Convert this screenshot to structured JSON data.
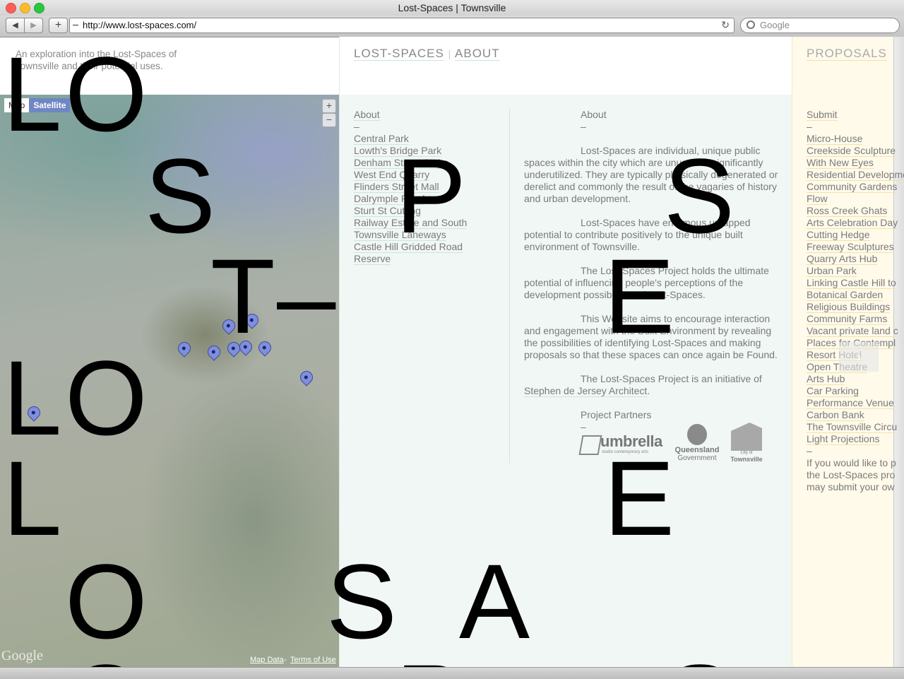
{
  "browser": {
    "window_title": "Lost-Spaces | Townsville",
    "url": "http://www.lost-spaces.com/",
    "search_placeholder": "Google",
    "back_glyph": "◀",
    "forward_glyph": "▶",
    "add_glyph": "+",
    "reload_glyph": "↻"
  },
  "site": {
    "tagline": "An exploration into the Lost-Spaces of Townsville and their potential uses.",
    "nav": {
      "brand": "LOST-SPACES",
      "separator": "|",
      "about": "ABOUT",
      "proposals": "PROPOSALS"
    }
  },
  "map": {
    "type_map": "Map",
    "type_satellite": "Satellite",
    "zoom_in": "+",
    "zoom_out": "−",
    "logo": "Google",
    "map_data": "Map Data",
    "terms_sep": " - ",
    "terms": "Terms of Use"
  },
  "places": {
    "heading": "About",
    "dash": "–",
    "items": [
      "Central Park",
      "Lowth's Bridge Park",
      "Denham Street Stairs",
      "West End Quarry",
      "Flinders Street Mall",
      "Dalrymple Road",
      "Sturt St Cutting",
      "Railway Estate and South",
      "Townsville Laneways",
      "Castle Hill Gridded Road",
      "Reserve"
    ]
  },
  "about": {
    "heading": "About",
    "dash": "–",
    "p1": "Lost-Spaces are individual, unique public spaces within the city which are unused or significantly underutilized. They are typically physically degenerated or derelict and commonly the result of the vagaries of history and urban development.",
    "p2": "Lost-Spaces have enormous untapped potential to contribute positively to the unique built environment of Townsville.",
    "p3": "The Lost-Spaces Project holds the ultimate potential of influencing people's perceptions of the development possibilities of Lost-Spaces.",
    "p4": "This Website aims to encourage interaction and engagement with the Built Environment by revealing the possibilities of identifying Lost-Spaces and making proposals so that these spaces can once again be Found.",
    "p5_prefix": "The Lost-Spaces Project is an initiative of",
    "p5_link": "Stephen de Jersey Architect",
    "p5_suffix": ".",
    "partners_heading": "Project Partners",
    "partners_dash": "–",
    "partner_umbrella": "umbrella",
    "partner_umbrella_sub": "studio contemporary arts",
    "partner_qld_1": "Queensland",
    "partner_qld_2": "Government",
    "partner_tsv_1": "City of",
    "partner_tsv_2": "Townsville"
  },
  "proposals": {
    "submit": "Submit",
    "dash": "–",
    "items": [
      "Micro-House",
      "Creekside Sculpture",
      "With New Eyes",
      "Residential Development",
      "Community Gardens",
      "Flow",
      "Ross Creek Ghats",
      "Arts Celebration Day",
      "Cutting Hedge",
      "Freeway Sculptures",
      "Quarry Arts Hub",
      "Urban Park",
      "Linking Castle Hill to",
      "Botanical Garden",
      "Religious Buildings",
      "Community Farms",
      "Vacant private land c",
      "Places for Contempl",
      "Resort Hotel",
      "Open Theatre",
      "Arts Hub",
      "Car Parking",
      "Performance Venue",
      "Carbon Bank",
      "The Townsville Circu",
      "Light Projections"
    ],
    "end_dash": "–",
    "footer_1": "If you would like to p",
    "footer_2": "the Lost-Spaces pro",
    "footer_3": "may submit your ow",
    "next_glyph": "›"
  },
  "overlay_letters": [
    "L",
    "O",
    "S",
    "P",
    "S",
    "T",
    "–",
    "E",
    "L",
    "O",
    "L",
    "E",
    "O",
    "S",
    "A",
    "O",
    "P",
    "S"
  ]
}
